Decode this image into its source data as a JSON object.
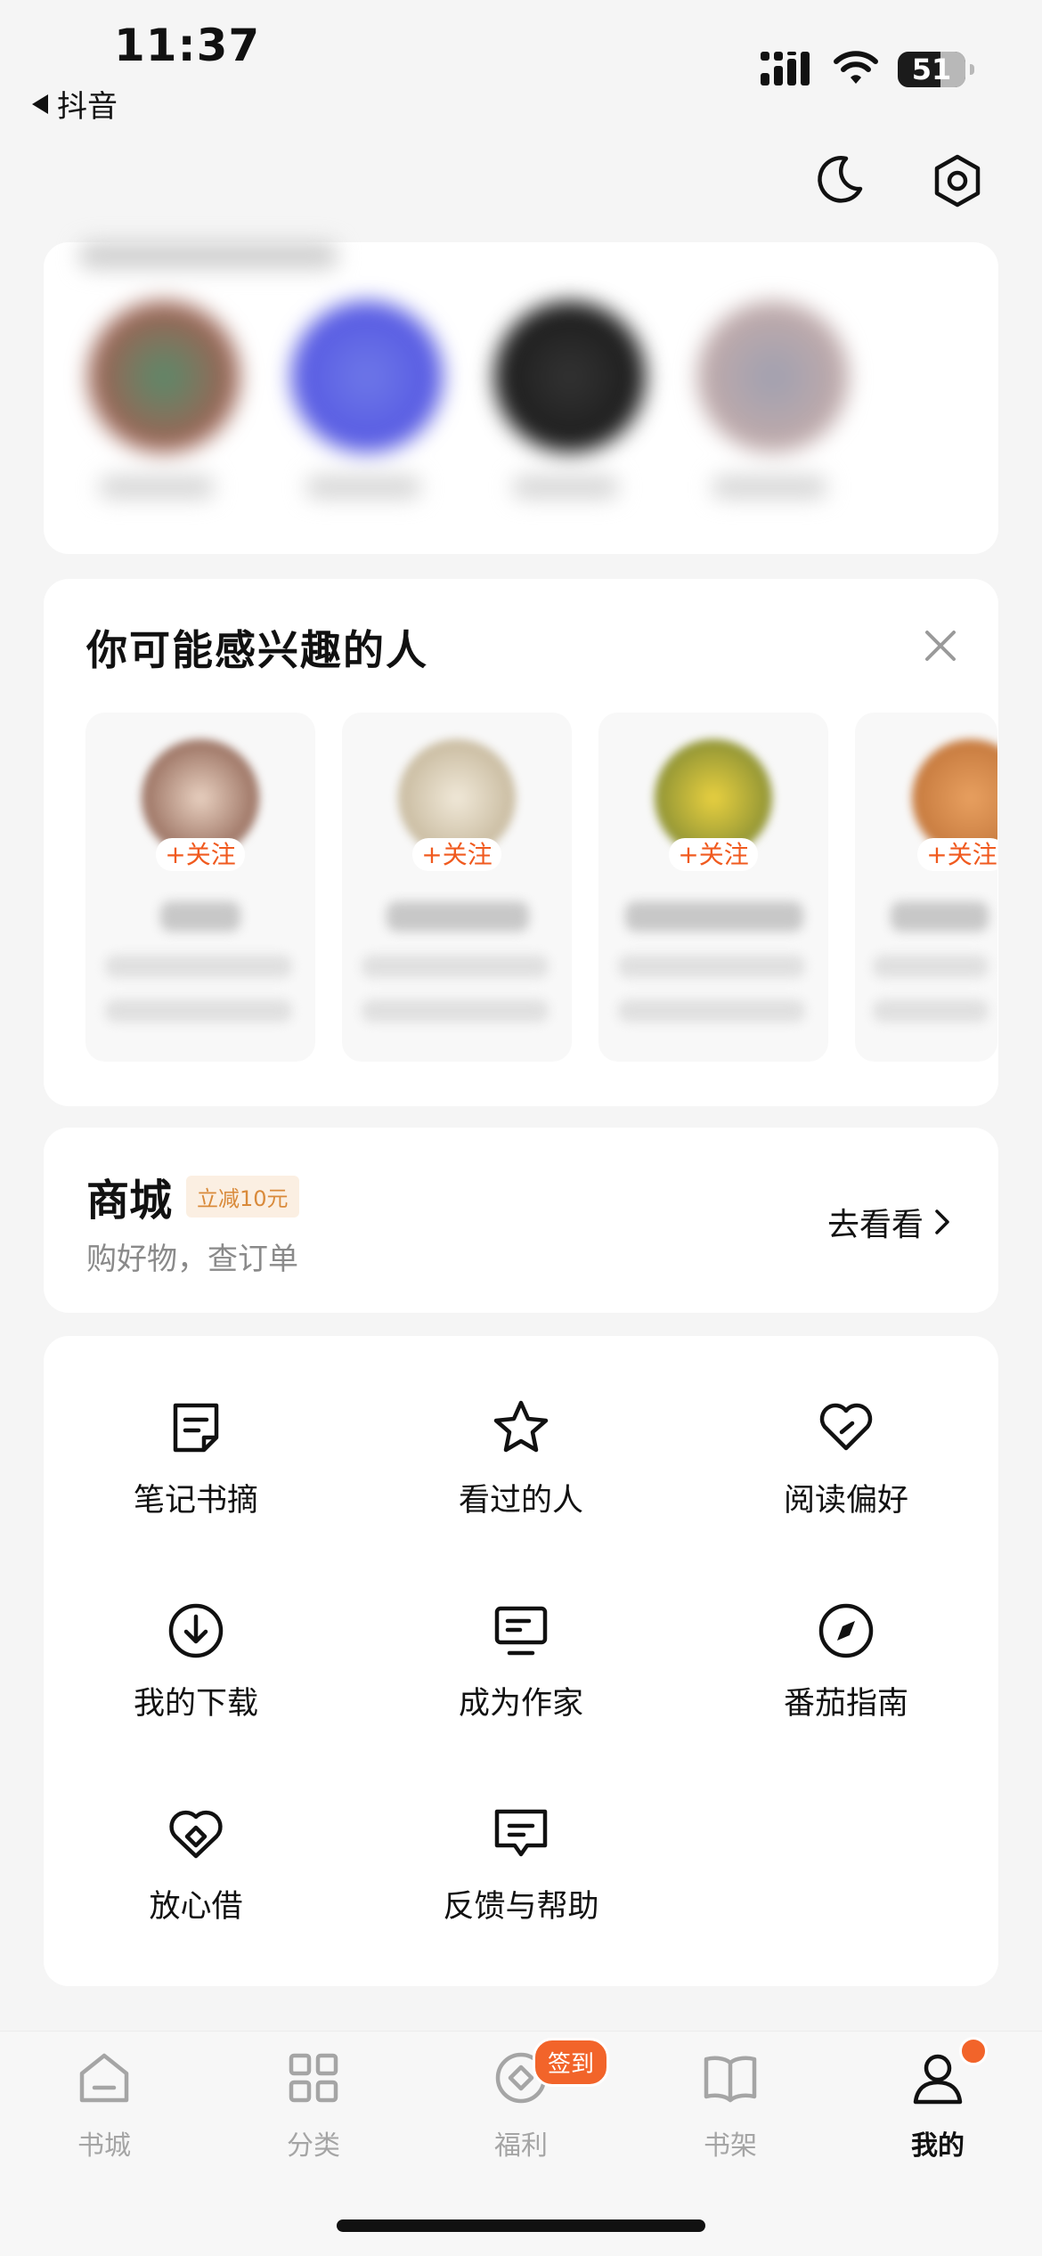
{
  "status_bar": {
    "time": "11:37",
    "back_label": "抖音",
    "battery": "51"
  },
  "header_icons": [
    "moon-icon",
    "settings-icon"
  ],
  "interest": {
    "title": "你可能感兴趣的人",
    "follow_label": "+关注"
  },
  "mall": {
    "title": "商城",
    "badge": "立减10元",
    "subtitle": "购好物，查订单",
    "link": "去看看"
  },
  "services": [
    {
      "label": "笔记书摘",
      "icon": "note-icon"
    },
    {
      "label": "看过的人",
      "icon": "star-icon"
    },
    {
      "label": "阅读偏好",
      "icon": "heart-icon"
    },
    {
      "label": "我的下载",
      "icon": "download-icon"
    },
    {
      "label": "成为作家",
      "icon": "monitor-icon"
    },
    {
      "label": "番茄指南",
      "icon": "compass-icon"
    },
    {
      "label": "放心借",
      "icon": "loan-icon"
    },
    {
      "label": "反馈与帮助",
      "icon": "feedback-icon"
    }
  ],
  "tabs": [
    {
      "label": "书城",
      "icon": "home-icon"
    },
    {
      "label": "分类",
      "icon": "grid-icon"
    },
    {
      "label": "福利",
      "icon": "coin-icon",
      "badge": "签到"
    },
    {
      "label": "书架",
      "icon": "book-icon"
    },
    {
      "label": "我的",
      "icon": "profile-icon",
      "active": true
    }
  ],
  "colors": {
    "accent": "#f2642a",
    "badge_text": "#d98a3a",
    "background": "#f5f5f5"
  }
}
